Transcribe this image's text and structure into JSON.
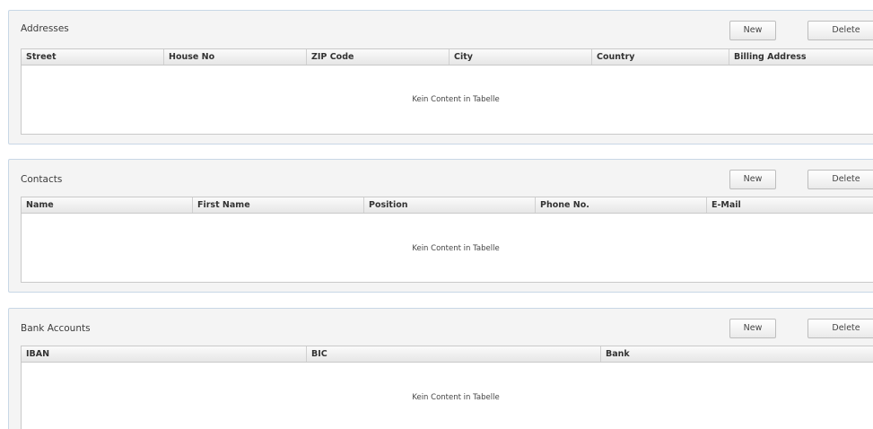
{
  "addresses": {
    "title": "Addresses",
    "new_label": "New",
    "delete_label": "Delete",
    "columns": [
      "Street",
      "House No",
      "ZIP Code",
      "City",
      "Country",
      "Billing Address"
    ],
    "empty_text": "Kein Content in Tabelle"
  },
  "contacts": {
    "title": "Contacts",
    "new_label": "New",
    "delete_label": "Delete",
    "columns": [
      "Name",
      "First Name",
      "Position",
      "Phone No.",
      "E-Mail"
    ],
    "empty_text": "Kein Content in Tabelle"
  },
  "bank_accounts": {
    "title": "Bank Accounts",
    "new_label": "New",
    "delete_label": "Delete",
    "columns": [
      "IBAN",
      "BIC",
      "Bank"
    ],
    "empty_text": "Kein Content in Tabelle"
  }
}
